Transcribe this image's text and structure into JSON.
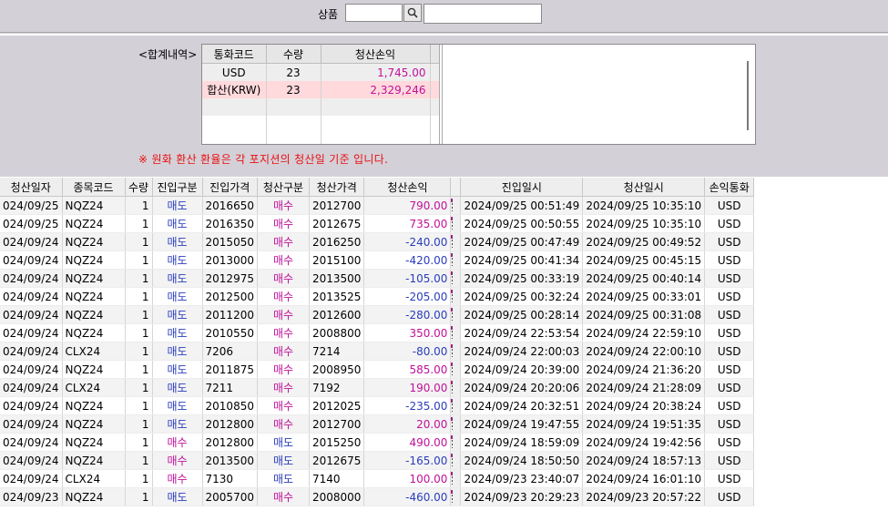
{
  "product": {
    "label": "상품",
    "code_value": "",
    "name_value": "",
    "search_icon": "search-icon"
  },
  "summary": {
    "label": "<합계내역>",
    "headers": [
      "통화코드",
      "수량",
      "청산손익"
    ],
    "rows": [
      {
        "currency": "USD",
        "qty": "23",
        "pnl": "1,745.00"
      },
      {
        "currency": "합산(KRW)",
        "qty": "23",
        "pnl": "2,329,246"
      }
    ],
    "note": "※ 원화 환산 환율은 각 포지션의 청산일 기준 입니다."
  },
  "grid": {
    "headers": [
      "청산일자",
      "종목코드",
      "수량",
      "진입구분",
      "진입가격",
      "청산구분",
      "청산가격",
      "청산손익",
      "",
      "진입일시",
      "청산일시",
      "손익통화"
    ],
    "rows": [
      {
        "d": "024/09/25",
        "sym": "NQZ24",
        "q": "1",
        "ent": "매도",
        "ep": "2016650",
        "cls": "매수",
        "cp": "2012700",
        "pnl": "790.00",
        "ed": "2024/09/25 00:51:49",
        "cd": "2024/09/25 10:35:10",
        "cur": "USD"
      },
      {
        "d": "024/09/25",
        "sym": "NQZ24",
        "q": "1",
        "ent": "매도",
        "ep": "2016350",
        "cls": "매수",
        "cp": "2012675",
        "pnl": "735.00",
        "ed": "2024/09/25 00:50:55",
        "cd": "2024/09/25 10:35:10",
        "cur": "USD"
      },
      {
        "d": "024/09/24",
        "sym": "NQZ24",
        "q": "1",
        "ent": "매도",
        "ep": "2015050",
        "cls": "매수",
        "cp": "2016250",
        "pnl": "-240.00",
        "ed": "2024/09/25 00:47:49",
        "cd": "2024/09/25 00:49:52",
        "cur": "USD"
      },
      {
        "d": "024/09/24",
        "sym": "NQZ24",
        "q": "1",
        "ent": "매도",
        "ep": "2013000",
        "cls": "매수",
        "cp": "2015100",
        "pnl": "-420.00",
        "ed": "2024/09/25 00:41:34",
        "cd": "2024/09/25 00:45:15",
        "cur": "USD"
      },
      {
        "d": "024/09/24",
        "sym": "NQZ24",
        "q": "1",
        "ent": "매도",
        "ep": "2012975",
        "cls": "매수",
        "cp": "2013500",
        "pnl": "-105.00",
        "ed": "2024/09/25 00:33:19",
        "cd": "2024/09/25 00:40:14",
        "cur": "USD"
      },
      {
        "d": "024/09/24",
        "sym": "NQZ24",
        "q": "1",
        "ent": "매도",
        "ep": "2012500",
        "cls": "매수",
        "cp": "2013525",
        "pnl": "-205.00",
        "ed": "2024/09/25 00:32:24",
        "cd": "2024/09/25 00:33:01",
        "cur": "USD"
      },
      {
        "d": "024/09/24",
        "sym": "NQZ24",
        "q": "1",
        "ent": "매도",
        "ep": "2011200",
        "cls": "매수",
        "cp": "2012600",
        "pnl": "-280.00",
        "ed": "2024/09/25 00:28:14",
        "cd": "2024/09/25 00:31:08",
        "cur": "USD"
      },
      {
        "d": "024/09/24",
        "sym": "NQZ24",
        "q": "1",
        "ent": "매도",
        "ep": "2010550",
        "cls": "매수",
        "cp": "2008800",
        "pnl": "350.00",
        "ed": "2024/09/24 22:53:54",
        "cd": "2024/09/24 22:59:10",
        "cur": "USD"
      },
      {
        "d": "024/09/24",
        "sym": "CLX24",
        "q": "1",
        "ent": "매도",
        "ep": "7206",
        "cls": "매수",
        "cp": "7214",
        "pnl": "-80.00",
        "ed": "2024/09/24 22:00:03",
        "cd": "2024/09/24 22:00:10",
        "cur": "USD"
      },
      {
        "d": "024/09/24",
        "sym": "NQZ24",
        "q": "1",
        "ent": "매도",
        "ep": "2011875",
        "cls": "매수",
        "cp": "2008950",
        "pnl": "585.00",
        "ed": "2024/09/24 20:39:00",
        "cd": "2024/09/24 21:36:20",
        "cur": "USD"
      },
      {
        "d": "024/09/24",
        "sym": "CLX24",
        "q": "1",
        "ent": "매도",
        "ep": "7211",
        "cls": "매수",
        "cp": "7192",
        "pnl": "190.00",
        "ed": "2024/09/24 20:20:06",
        "cd": "2024/09/24 21:28:09",
        "cur": "USD"
      },
      {
        "d": "024/09/24",
        "sym": "NQZ24",
        "q": "1",
        "ent": "매도",
        "ep": "2010850",
        "cls": "매수",
        "cp": "2012025",
        "pnl": "-235.00",
        "ed": "2024/09/24 20:32:51",
        "cd": "2024/09/24 20:38:24",
        "cur": "USD"
      },
      {
        "d": "024/09/24",
        "sym": "NQZ24",
        "q": "1",
        "ent": "매도",
        "ep": "2012800",
        "cls": "매수",
        "cp": "2012700",
        "pnl": "20.00",
        "ed": "2024/09/24 19:47:55",
        "cd": "2024/09/24 19:51:35",
        "cur": "USD"
      },
      {
        "d": "024/09/24",
        "sym": "NQZ24",
        "q": "1",
        "ent": "매수",
        "ep": "2012800",
        "cls": "매도",
        "cp": "2015250",
        "pnl": "490.00",
        "ed": "2024/09/24 18:59:09",
        "cd": "2024/09/24 19:42:56",
        "cur": "USD"
      },
      {
        "d": "024/09/24",
        "sym": "NQZ24",
        "q": "1",
        "ent": "매수",
        "ep": "2013500",
        "cls": "매도",
        "cp": "2012675",
        "pnl": "-165.00",
        "ed": "2024/09/24 18:50:50",
        "cd": "2024/09/24 18:57:13",
        "cur": "USD"
      },
      {
        "d": "024/09/24",
        "sym": "CLX24",
        "q": "1",
        "ent": "매수",
        "ep": "7130",
        "cls": "매도",
        "cp": "7140",
        "pnl": "100.00",
        "ed": "2024/09/23 23:40:07",
        "cd": "2024/09/24 16:01:10",
        "cur": "USD"
      },
      {
        "d": "024/09/23",
        "sym": "NQZ24",
        "q": "1",
        "ent": "매도",
        "ep": "2005700",
        "cls": "매수",
        "cp": "2008000",
        "pnl": "-460.00",
        "ed": "2024/09/23 20:29:23",
        "cd": "2024/09/23 20:57:22",
        "cur": "USD"
      }
    ]
  },
  "colors": {
    "sell": "#2a3dbb",
    "buy": "#c0119a",
    "note": "#e81010",
    "summary_krw_row": "#ffd9dc",
    "panel_bg": "#d4d0d8"
  }
}
